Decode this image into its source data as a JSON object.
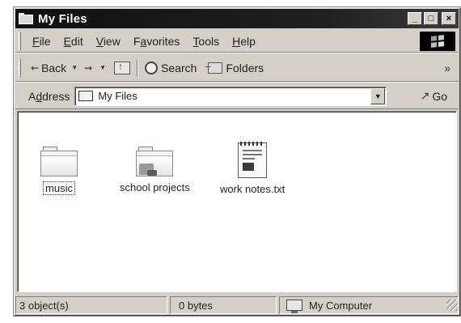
{
  "window": {
    "title": "My Files"
  },
  "title_buttons": {
    "minimize": "_",
    "maximize": "□",
    "close": "×"
  },
  "menu": {
    "items": [
      {
        "label": "File",
        "accel": "F"
      },
      {
        "label": "Edit",
        "accel": "E"
      },
      {
        "label": "View",
        "accel": "V"
      },
      {
        "label": "Favorites",
        "accel": "a"
      },
      {
        "label": "Tools",
        "accel": "T"
      },
      {
        "label": "Help",
        "accel": "H"
      }
    ]
  },
  "toolbar": {
    "back_label": "Back",
    "search_label": "Search",
    "folders_label": "Folders",
    "more": "»"
  },
  "address": {
    "label": "Address",
    "value": "My Files",
    "go_label": "Go"
  },
  "files": [
    {
      "name": "music",
      "type": "folder",
      "selected": true
    },
    {
      "name": "school projects",
      "type": "shared-folder",
      "selected": false
    },
    {
      "name": "work notes.txt",
      "type": "text-file",
      "selected": false
    }
  ],
  "status": {
    "objects": "3 object(s)",
    "size": "0 bytes",
    "zone": "My Computer"
  }
}
